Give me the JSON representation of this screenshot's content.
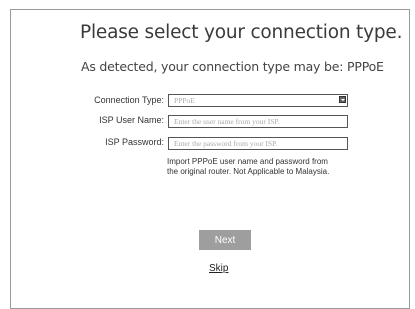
{
  "page": {
    "title": "Please select your connection type.",
    "subtitle": "As detected, your connection type may be: PPPoE"
  },
  "form": {
    "connection_type": {
      "label": "Connection Type:",
      "value": "PPPoE"
    },
    "isp_user_name": {
      "label": "ISP User Name:",
      "placeholder": "Enter the user name from your ISP."
    },
    "isp_password": {
      "label": "ISP Password:",
      "placeholder": "Enter the password from your ISP."
    },
    "note_line1": "Import PPPoE user name and password from",
    "note_line2": "the original router. Not Applicable to Malaysia."
  },
  "actions": {
    "next_label": "Next",
    "skip_label": "Skip"
  },
  "colors": {
    "next_button_bg": "#9e9e9e",
    "border": "#9a9a9a"
  }
}
